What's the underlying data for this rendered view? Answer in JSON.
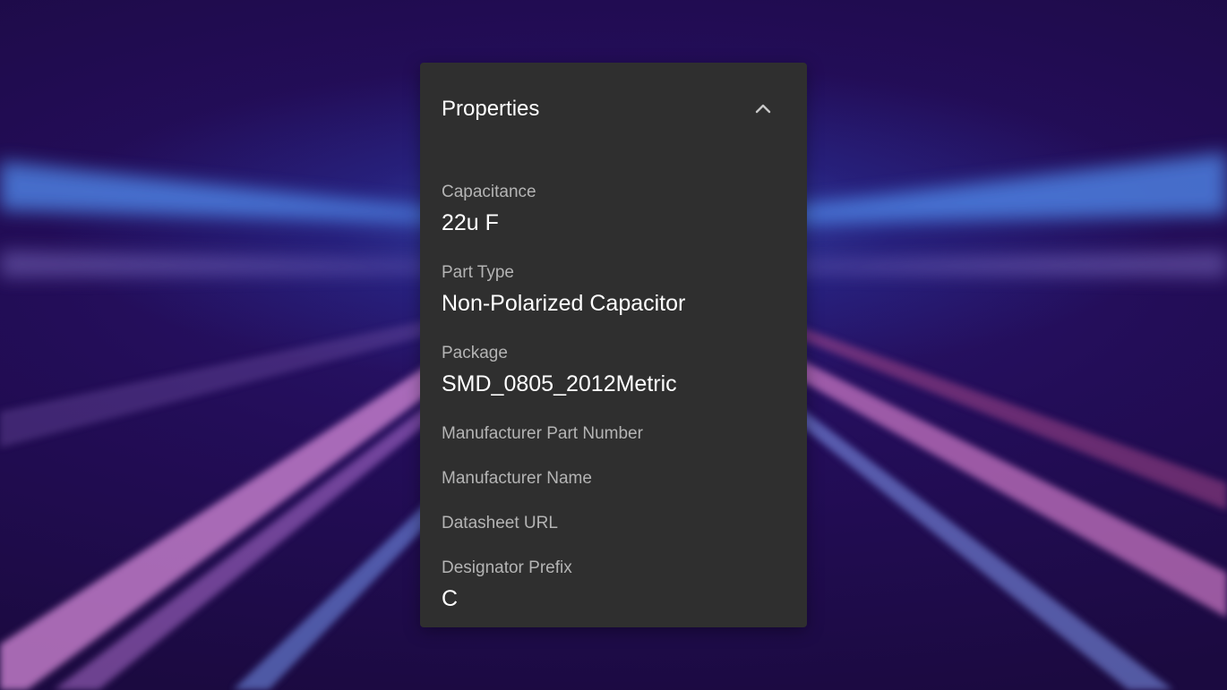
{
  "panel": {
    "title": "Properties",
    "collapse_icon": "chevron-up-icon"
  },
  "properties": [
    {
      "label": "Capacitance",
      "value": "22u F"
    },
    {
      "label": "Part Type",
      "value": "Non-Polarized Capacitor"
    },
    {
      "label": "Package",
      "value": "SMD_0805_2012Metric"
    },
    {
      "label": "Manufacturer Part Number",
      "value": ""
    },
    {
      "label": "Manufacturer Name",
      "value": ""
    },
    {
      "label": "Datasheet URL",
      "value": ""
    },
    {
      "label": "Designator Prefix",
      "value": "C"
    }
  ],
  "colors": {
    "panel_background": "#2f2f2f",
    "label_text": "#b4b4b4",
    "value_text": "#ffffff"
  }
}
